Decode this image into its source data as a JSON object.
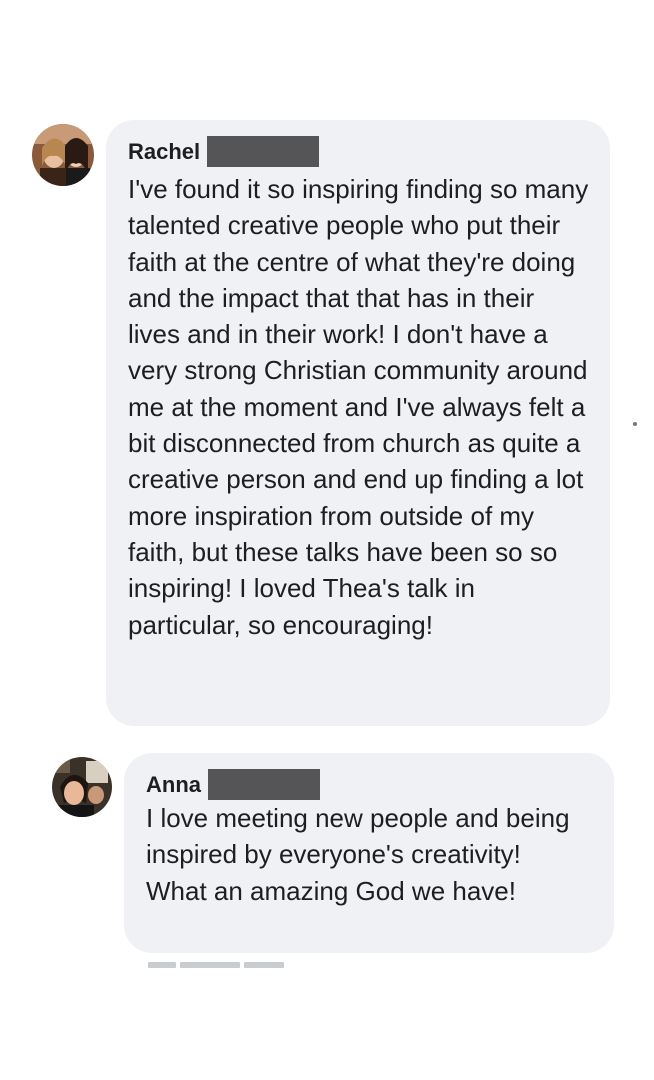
{
  "comments": [
    {
      "author": "Rachel",
      "avatar_icon": "user-photo-avatar",
      "redacted_surname": true,
      "text": "I've found it so inspiring finding so many talented creative people who put their faith at the centre of what they're doing and the impact that that has in their lives and in their work! I don't have a very strong Christian community around me at the moment and I've always felt a bit disconnected from church as quite a creative person and end up finding a lot more inspiration from outside of my faith, but these talks have been so so inspiring! I loved Thea's talk in particular, so encouraging!"
    },
    {
      "author": "Anna",
      "avatar_icon": "user-photo-avatar",
      "redacted_surname": true,
      "text": "I love meeting new people and being inspired by everyone's creativity! What an amazing God we have!"
    }
  ],
  "colors": {
    "bubble_background": "#f0f1f5",
    "text": "#1c1e21",
    "redaction": "#555558"
  }
}
